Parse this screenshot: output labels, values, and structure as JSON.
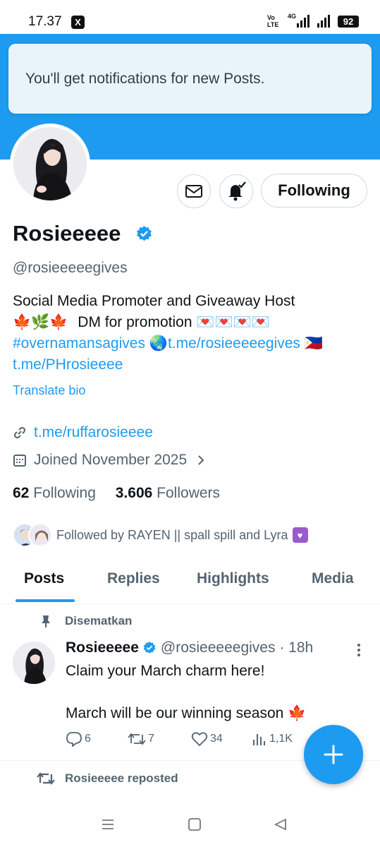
{
  "status_bar": {
    "time": "17.37",
    "x_app": "X",
    "volte_top": "Vo",
    "volte_bottom": "LTE",
    "network": "4G",
    "battery": "92"
  },
  "toast": {
    "text": "You'll get notifications for new Posts."
  },
  "actions": {
    "following_label": "Following"
  },
  "profile": {
    "name": "Rosieeeee",
    "handle": "@rosieeeeegives",
    "bio_line1": "Social Media Promoter and Giveaway Host",
    "bio_line2_emoji": "🍁🌿🍁",
    "bio_line2_text": "DM for promotion",
    "bio_line2_emoji_end": "💌💌💌💌",
    "bio_hashtag": "#overnamansagives",
    "bio_globe": "🌏",
    "bio_link1": "t.me/rosieeeeegives",
    "bio_flag": "🇵🇭",
    "bio_link2": "t.me/PHrosieeee",
    "translate_label": "Translate bio",
    "website": "t.me/ruffarosieeee",
    "joined": "Joined November 2025",
    "following_count": "62",
    "following_label": "Following",
    "followers_count": "3.606",
    "followers_label": "Followers",
    "followed_by": "Followed by RAYEN || spall spill and Lyra",
    "followed_by_emoji": "♥"
  },
  "tabs": [
    {
      "label": "Posts",
      "active": true
    },
    {
      "label": "Replies"
    },
    {
      "label": "Highlights"
    },
    {
      "label": "Media"
    }
  ],
  "pinned_label": "Disematkan",
  "tweet": {
    "author": "Rosieeeee",
    "handle_time": "@rosieeeeegives · 18h",
    "line1": "Claim your March charm here!",
    "line2": "March will be our winning season",
    "line2_emoji": "🍁",
    "replies": "6",
    "reposts": "7",
    "likes": "34",
    "views": "1,1K"
  },
  "repost_label": "Rosieeeee reposted",
  "colors": {
    "accent": "#1d9bf0",
    "text_primary": "#0f1419",
    "text_secondary": "#536471",
    "banner": "#1d9bf0"
  }
}
